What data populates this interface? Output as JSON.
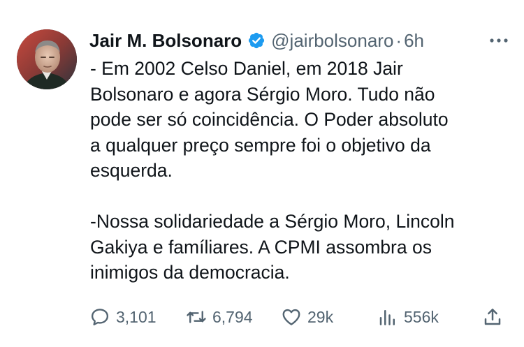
{
  "author": {
    "name": "Jair M. Bolsonaro",
    "handle": "@jairbolsonaro",
    "separator": "·",
    "time": "6h"
  },
  "tweet": {
    "paragraph_1": "- Em 2002 Celso Daniel, em 2018 Jair\nBolsonaro e agora Sérgio Moro. Tudo não\npode ser só coincidência. O Poder absoluto\na qualquer preço sempre foi o objetivo da\nesquerda.",
    "paragraph_2": "-Nossa solidariedade a Sérgio Moro, Lincoln\nGakiya e famíliares. A CPMI assombra os\ninimigos da democracia."
  },
  "stats": {
    "replies": "3,101",
    "reposts": "6,794",
    "likes": "29k",
    "views": "556k"
  },
  "colors": {
    "text": "#0f1419",
    "muted": "#536471",
    "verified": "#1d9bf0"
  },
  "icons": [
    "verified-badge-icon",
    "more-icon",
    "reply-icon",
    "repost-icon",
    "like-icon",
    "views-icon",
    "share-icon"
  ]
}
